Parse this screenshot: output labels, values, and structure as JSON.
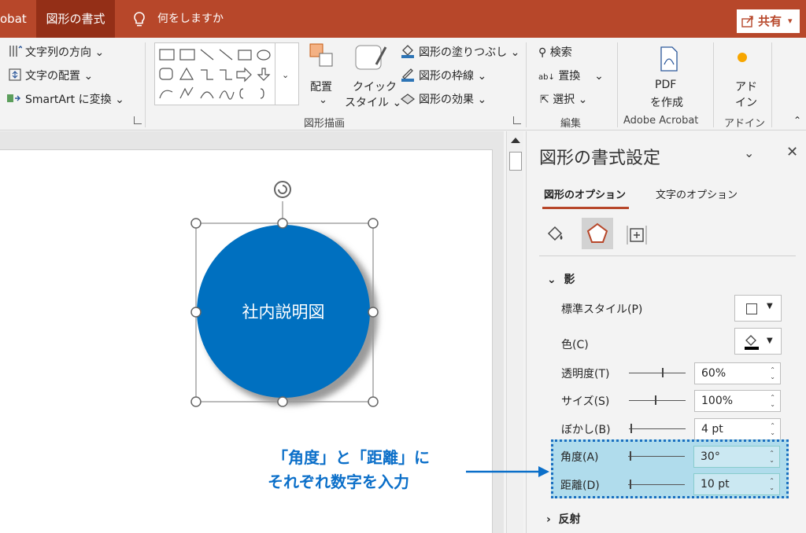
{
  "titlebar": {
    "app_fragment": "obat",
    "active_tab": "図形の書式",
    "search_text": "何をしますか",
    "share_label": "共有",
    "accent": "#b7472a"
  },
  "ribbon": {
    "text_group": {
      "direction": "文字列の方向",
      "align": "文字の配置",
      "smartart": "SmartArt に変換"
    },
    "arrange_label": "配置",
    "quick_style_line1": "クイック",
    "quick_style_line2": "スタイル",
    "fill": "図形の塗りつぶし",
    "outline": "図形の枠線",
    "effects": "図形の効果",
    "drawing_group": "図形描画",
    "find": "検索",
    "replace": "置換",
    "select": "選択",
    "edit_group": "編集",
    "pdf_line1": "PDF",
    "pdf_line2": "を作成",
    "acrobat_group": "Adobe Acrobat",
    "addin_line1": "アド",
    "addin_line2": "イン",
    "addin_group": "アドイン"
  },
  "slide": {
    "shape_text": "社内説明図",
    "shape_color": "#0070c0"
  },
  "pane": {
    "title": "図形の書式設定",
    "tab_shape": "図形のオプション",
    "tab_text": "文字のオプション",
    "section_shadow": "影",
    "section_reflection": "反射",
    "preset_label": "標準スタイル(P)",
    "color_label": "色(C)",
    "transparency_label": "透明度(T)",
    "transparency_value": "60%",
    "size_label": "サイズ(S)",
    "size_value": "100%",
    "blur_label": "ぼかし(B)",
    "blur_value": "4 pt",
    "angle_label": "角度(A)",
    "angle_value": "30°",
    "distance_label": "距離(D)",
    "distance_value": "10 pt"
  },
  "annotation": {
    "line1": "「角度」と「距離」に",
    "line2": "それぞれ数字を入力",
    "color": "#0b6fc9"
  }
}
